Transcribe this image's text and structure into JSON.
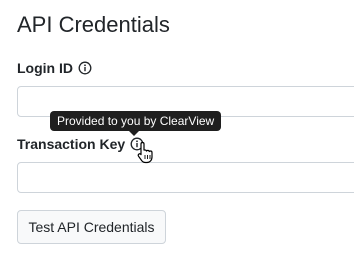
{
  "title": "API Credentials",
  "login": {
    "label": "Login ID",
    "value": "",
    "info_icon": "info-circle-icon"
  },
  "transaction": {
    "label": "Transaction Key",
    "value": "",
    "info_icon": "info-circle-icon"
  },
  "tooltip": {
    "text": "Provided to you by ClearView"
  },
  "test_button": {
    "label": "Test API Credentials"
  },
  "cursor": "pointer-cursor-icon"
}
